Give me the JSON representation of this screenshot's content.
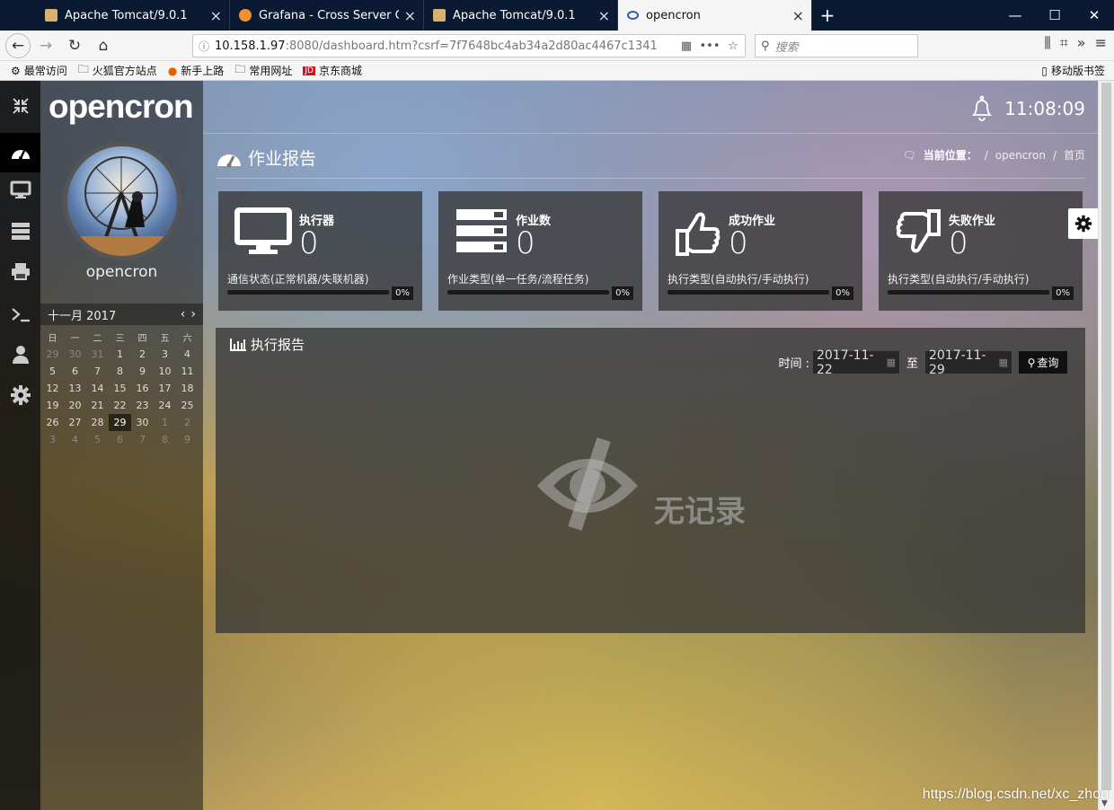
{
  "browser": {
    "tabs": [
      {
        "title": "Apache Tomcat/9.0.1",
        "active": false
      },
      {
        "title": "Grafana - Cross Server Graph",
        "active": false
      },
      {
        "title": "Apache Tomcat/9.0.1",
        "active": false
      },
      {
        "title": "opencron",
        "active": true
      }
    ],
    "close_glyph": "×",
    "new_tab_glyph": "+",
    "window_buttons": [
      "—",
      "☐",
      "✕"
    ],
    "url_host": "10.158.1.97",
    "url_rest": ":8080/dashboard.htm?csrf=7f7648bc4ab34a2d80ac4467c1341",
    "search_placeholder": "搜索",
    "bookmarks": [
      "最常访问",
      "火狐官方站点",
      "新手上路",
      "常用网址",
      "京东商城"
    ],
    "mobile_bookmarks": "移动版书签"
  },
  "app": {
    "logo": "opencron",
    "clock": "11:08:09",
    "username": "opencron",
    "page_title": "作业报告",
    "breadcrumb": {
      "label": "当前位置：",
      "items": [
        "opencron",
        "首页"
      ],
      "sep": "/"
    },
    "calendar": {
      "title": "十一月 2017",
      "weekdays": [
        "日",
        "一",
        "二",
        "三",
        "四",
        "五",
        "六"
      ],
      "days": [
        [
          "29",
          "30",
          "31",
          "1",
          "2",
          "3",
          "4"
        ],
        [
          "5",
          "6",
          "7",
          "8",
          "9",
          "10",
          "11"
        ],
        [
          "12",
          "13",
          "14",
          "15",
          "16",
          "17",
          "18"
        ],
        [
          "19",
          "20",
          "21",
          "22",
          "23",
          "24",
          "25"
        ],
        [
          "26",
          "27",
          "28",
          "29",
          "30",
          "1",
          "2"
        ],
        [
          "3",
          "4",
          "5",
          "6",
          "7",
          "8",
          "9"
        ]
      ],
      "selected": "29"
    },
    "cards": [
      {
        "title": "执行器",
        "value": "0",
        "desc": "通信状态(正常机器/失联机器)",
        "progress": 0,
        "pct": "0%"
      },
      {
        "title": "作业数",
        "value": "0",
        "desc": "作业类型(单一任务/流程任务)",
        "progress": 0,
        "pct": "0%"
      },
      {
        "title": "成功作业",
        "value": "0",
        "desc": "执行类型(自动执行/手动执行)",
        "progress": 0,
        "pct": "0%"
      },
      {
        "title": "失败作业",
        "value": "0",
        "desc": "执行类型(自动执行/手动执行)",
        "progress": 0,
        "pct": "0%"
      }
    ],
    "report": {
      "title": "执行报告",
      "time_label": "时间 :",
      "start_date": "2017-11-22",
      "to_label": "至",
      "end_date": "2017-11-29",
      "query_label": "查询",
      "empty_text": "无记录"
    }
  },
  "watermark": "https://blog.csdn.net/xc_zhou",
  "colors": {
    "tabbar": "#0b1a33",
    "accent": "#4aa3df"
  }
}
